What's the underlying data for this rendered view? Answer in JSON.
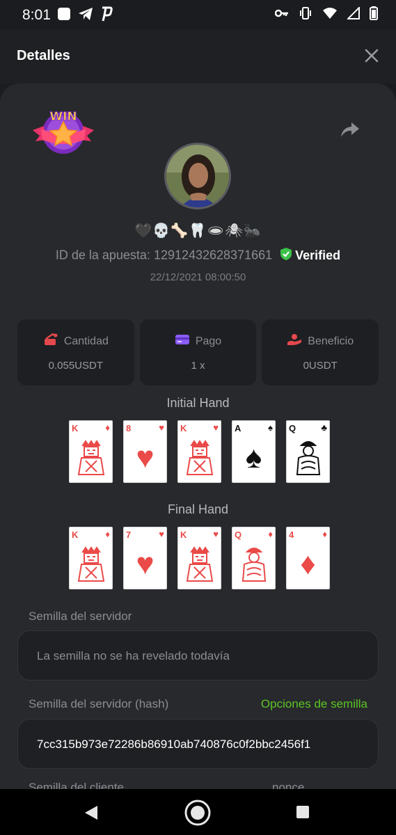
{
  "status_bar": {
    "time": "8:01"
  },
  "header": {
    "title": "Detalles"
  },
  "bet": {
    "username": "🖤💀🦴🦷🕳🕷🐜",
    "id_label": "ID de la apuesta:",
    "id_value": "12912432628371661",
    "verified_label": "Verified",
    "date": "22/12/2021 08:00:50"
  },
  "badge": {
    "text": "WIN"
  },
  "stats": [
    {
      "label": "Cantidad",
      "value": "0.055USDT",
      "icon": "coins-icon",
      "color": "#e5484d"
    },
    {
      "label": "Pago",
      "value": "1 x",
      "icon": "card-icon",
      "color": "#8b5cf6"
    },
    {
      "label": "Beneficio",
      "value": "0USDT",
      "icon": "hand-coin-icon",
      "color": "#e5484d"
    }
  ],
  "initial_hand": {
    "title": "Initial Hand",
    "cards": [
      {
        "rank": "K",
        "suit": "♦",
        "color": "red"
      },
      {
        "rank": "8",
        "suit": "♥",
        "color": "red"
      },
      {
        "rank": "K",
        "suit": "♥",
        "color": "red"
      },
      {
        "rank": "A",
        "suit": "♠",
        "color": "black"
      },
      {
        "rank": "Q",
        "suit": "♣",
        "color": "black"
      }
    ]
  },
  "final_hand": {
    "title": "Final Hand",
    "cards": [
      {
        "rank": "K",
        "suit": "♦",
        "color": "red"
      },
      {
        "rank": "7",
        "suit": "♥",
        "color": "red"
      },
      {
        "rank": "K",
        "suit": "♥",
        "color": "red"
      },
      {
        "rank": "Q",
        "suit": "♦",
        "color": "red"
      },
      {
        "rank": "4",
        "suit": "♦",
        "color": "red"
      }
    ]
  },
  "server_seed": {
    "label": "Semilla del servidor",
    "value": "La semilla no se ha revelado todavía"
  },
  "server_seed_hash": {
    "label": "Semilla del servidor (hash)",
    "options_label": "Opciones de semilla",
    "value": "7cc315b973e72286b86910ab740876c0f2bbc2456f1"
  },
  "client_seed": {
    "label": "Semilla del cliente",
    "nonce_label": "nonce"
  },
  "colors": {
    "accent_green": "#5cc526",
    "panel": "#28292c",
    "background": "#1b1c1f"
  }
}
